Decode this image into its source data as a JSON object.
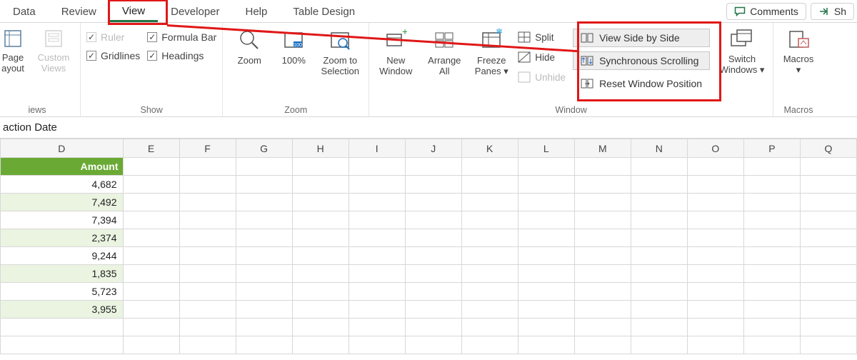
{
  "tabs": {
    "items": [
      "Data",
      "Review",
      "View",
      "Developer",
      "Help",
      "Table Design"
    ],
    "active": "View"
  },
  "top_right": {
    "comments": "Comments",
    "share": "Sh"
  },
  "ribbon": {
    "views": {
      "page_layout": "Page\nayout",
      "custom_views": "Custom\nViews",
      "group_label": "iews"
    },
    "show": {
      "ruler": "Ruler",
      "formula_bar": "Formula Bar",
      "gridlines": "Gridlines",
      "headings": "Headings",
      "group_label": "Show"
    },
    "zoom": {
      "zoom": "Zoom",
      "hundred": "100%",
      "zoom_to_selection": "Zoom to\nSelection",
      "group_label": "Zoom"
    },
    "window": {
      "new_window": "New\nWindow",
      "arrange_all": "Arrange\nAll",
      "freeze_panes": "Freeze\nPanes ▾",
      "split": "Split",
      "hide": "Hide",
      "unhide": "Unhide",
      "view_side_by_side": "View Side by Side",
      "synchronous_scrolling": "Synchronous Scrolling",
      "reset_window_position": "Reset Window Position",
      "switch_windows": "Switch\nWindows ▾",
      "group_label": "Window"
    },
    "macros": {
      "macros": "Macros\n▾",
      "group_label": "Macros"
    }
  },
  "formula_bar_text": "action Date",
  "grid": {
    "col_headers": [
      "D",
      "E",
      "F",
      "G",
      "H",
      "I",
      "J",
      "K",
      "L",
      "M",
      "N",
      "O",
      "P",
      "Q"
    ],
    "amount_header": "Amount",
    "amounts": [
      "4,682",
      "7,492",
      "7,394",
      "2,374",
      "9,244",
      "1,835",
      "5,723",
      "3,955"
    ]
  }
}
